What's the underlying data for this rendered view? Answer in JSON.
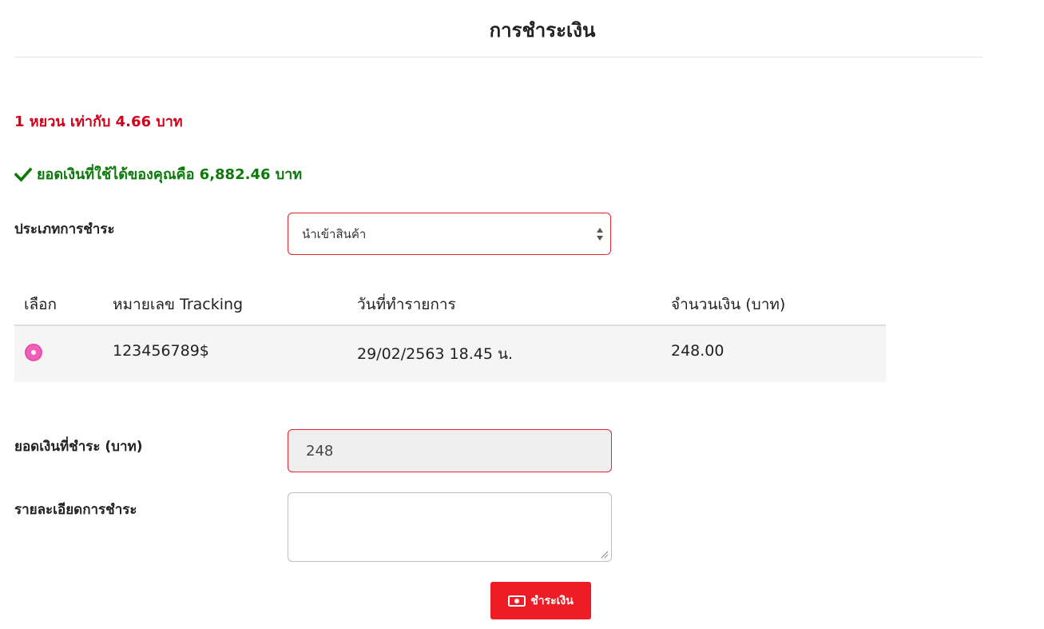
{
  "page": {
    "title": "การชำระเงิน"
  },
  "rate": {
    "text": "1 หยวน เท่ากับ 4.66 บาท",
    "color": "#d0021b"
  },
  "balance": {
    "text": "ยอดเงินที่ใช้ได้ของคุณคือ 6,882.46 บาท",
    "icon": "check-icon",
    "color": "#0b7a0b"
  },
  "payment_type": {
    "label": "ประเภทการชำระ",
    "selected": "นำเข้าสินค้า"
  },
  "table": {
    "columns": [
      "เลือก",
      "หมายเลข Tracking",
      "วันที่ทำรายการ",
      "จำนวนเงิน (บาท)"
    ],
    "rows": [
      {
        "selected": true,
        "tracking": "123456789$",
        "date": "29/02/2563 18.45 น.",
        "amount": "248.00"
      }
    ]
  },
  "amount_field": {
    "label": "ยอดเงินที่ชำระ (บาท)",
    "value": "248"
  },
  "detail_field": {
    "label": "รายละเอียดการชำระ",
    "value": ""
  },
  "pay_button": {
    "label": "ชำระเงิน",
    "icon": "money-icon",
    "color": "#ee1c25"
  }
}
